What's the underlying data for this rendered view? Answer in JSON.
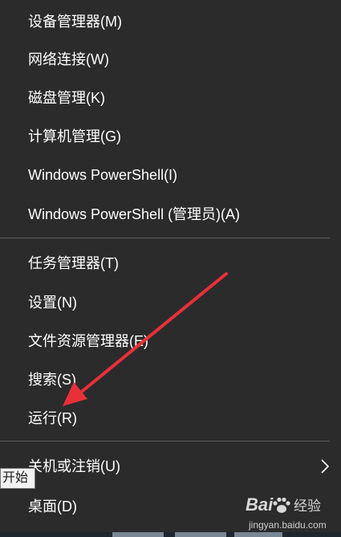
{
  "menu": {
    "items": [
      {
        "label": "设备管理器(M)"
      },
      {
        "label": "网络连接(W)"
      },
      {
        "label": "磁盘管理(K)"
      },
      {
        "label": "计算机管理(G)"
      },
      {
        "label": "Windows PowerShell(I)"
      },
      {
        "label": "Windows PowerShell (管理员)(A)"
      },
      {
        "label": "任务管理器(T)"
      },
      {
        "label": "设置(N)"
      },
      {
        "label": "文件资源管理器(E)"
      },
      {
        "label": "搜索(S)"
      },
      {
        "label": "运行(R)"
      },
      {
        "label": "关机或注销(U)"
      },
      {
        "label": "桌面(D)"
      }
    ]
  },
  "tooltip": {
    "text": "开始"
  },
  "watermark": {
    "brand": "Bai",
    "brand_cn": "经验",
    "url": "jingyan.baidu.com"
  },
  "icons": {
    "submenu": "chevron-right-icon",
    "annotation": "red-arrow-annotation"
  },
  "colors": {
    "menu_bg": "#2b2b2b",
    "text": "#ffffff",
    "separator": "#5c5c5c",
    "annotation_arrow": "#e8303a"
  }
}
